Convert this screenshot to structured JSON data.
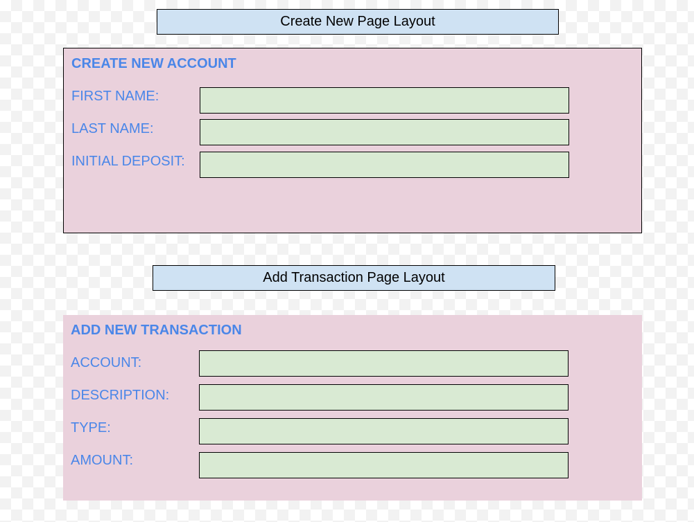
{
  "create_layout": {
    "title": "Create New Page Layout",
    "heading": "CREATE NEW ACCOUNT",
    "fields": [
      {
        "label": "FIRST NAME:"
      },
      {
        "label": "LAST NAME:"
      },
      {
        "label": "INITIAL DEPOSIT:"
      }
    ]
  },
  "transaction_layout": {
    "title": "Add Transaction Page Layout",
    "heading": "ADD NEW TRANSACTION",
    "fields": [
      {
        "label": "ACCOUNT:"
      },
      {
        "label": "DESCRIPTION:"
      },
      {
        "label": "TYPE:"
      },
      {
        "label": "AMOUNT:"
      }
    ]
  },
  "colors": {
    "title_fill": "#cfe2f3",
    "panel_fill": "#ead1dc",
    "field_fill": "#d9ead3",
    "label_text": "#4a86e8"
  }
}
